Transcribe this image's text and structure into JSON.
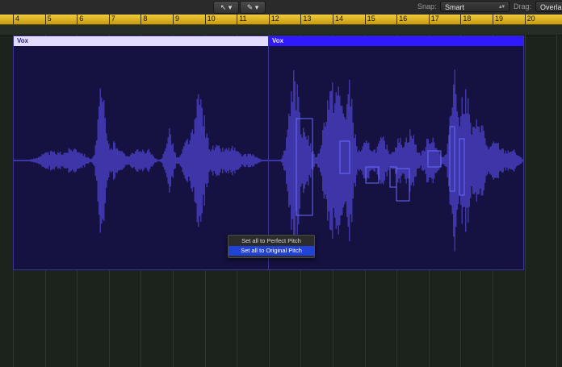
{
  "toolbar": {
    "pointer_tool_icon": "pointer-arrow-icon",
    "pencil_tool_icon": "pencil-icon",
    "snap_label": "Snap:",
    "snap_value": "Smart",
    "drag_label": "Drag:",
    "drag_value": "Overla"
  },
  "ruler": {
    "bars": [
      "4",
      "5",
      "6",
      "7",
      "8",
      "9",
      "10",
      "11",
      "12",
      "13",
      "14",
      "15",
      "16",
      "17",
      "18",
      "19",
      "20"
    ]
  },
  "regions": [
    {
      "name": "Vox"
    },
    {
      "name": "Vox"
    }
  ],
  "context_menu": {
    "items": [
      "Set all to Perfect Pitch",
      "Set all to Original Pitch"
    ],
    "highlighted_index": 1
  },
  "colors": {
    "ruler": "#e3b520",
    "region_selected_header": "#2f19ff",
    "region_header": "#e4dcff",
    "waveform": "#3e35a8",
    "menu_highlight": "#2142d6"
  }
}
